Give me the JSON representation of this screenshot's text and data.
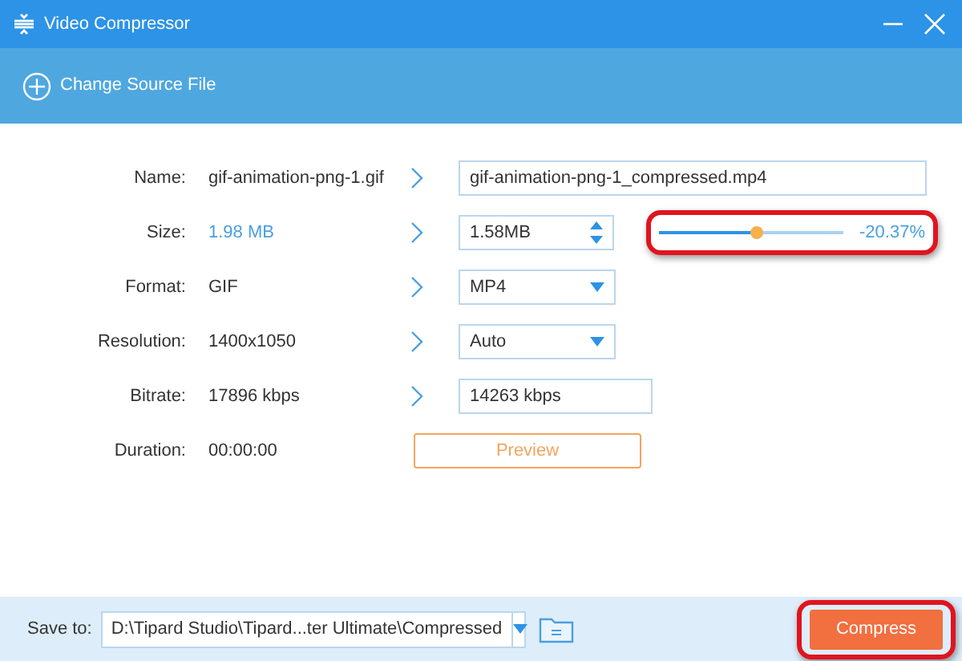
{
  "window": {
    "title": "Video Compressor"
  },
  "toolbar": {
    "action": "Change Source File"
  },
  "fields": [
    {
      "kind": "text",
      "label": "Name:",
      "source": "gif-animation-png-1.gif",
      "value": "gif-animation-png-1_compressed.mp4"
    },
    {
      "kind": "spinner",
      "label": "Size:",
      "source": "1.98 MB",
      "value": "1.58MB",
      "slider": {
        "level": 0.53,
        "reading": "-20.37%",
        "highlighted": true
      }
    },
    {
      "kind": "select",
      "label": "Format:",
      "source": "GIF",
      "value": "MP4"
    },
    {
      "kind": "select",
      "label": "Resolution:",
      "source": "1400x1050",
      "value": "Auto"
    },
    {
      "kind": "short_text",
      "label": "Bitrate:",
      "source": "17896 kbps",
      "value": "14263 kbps"
    },
    {
      "kind": "button",
      "label": "Duration:",
      "source": "00:00:00",
      "value": "Preview"
    }
  ],
  "footer": {
    "label": "Save to:",
    "path": "D:\\Tipard Studio\\Tipard...ter Ultimate\\Compressed",
    "button": "Compress",
    "button_highlighted": true
  }
}
